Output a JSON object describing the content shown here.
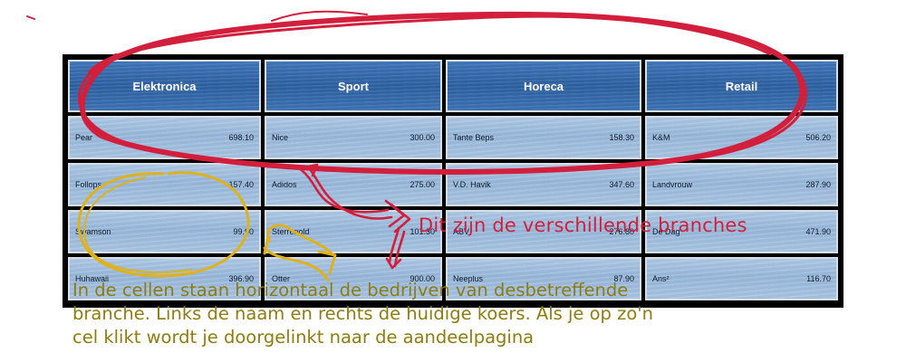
{
  "table": {
    "headers": [
      "Elektronica",
      "Sport",
      "Horeca",
      "Retail"
    ],
    "rows": [
      [
        {
          "name": "Pear",
          "price": "698.10"
        },
        {
          "name": "Nice",
          "price": "300.00"
        },
        {
          "name": "Tante Beps",
          "price": "158.30"
        },
        {
          "name": "K&M",
          "price": "506.20"
        }
      ],
      [
        {
          "name": "Follops",
          "price": "157.40"
        },
        {
          "name": "Adidos",
          "price": "275.00"
        },
        {
          "name": "V.D. Havik",
          "price": "347.60"
        },
        {
          "name": "Landvrouw",
          "price": "287.90"
        }
      ],
      [
        {
          "name": "Swamson",
          "price": "99.90"
        },
        {
          "name": "Sterrenold",
          "price": "101.30"
        },
        {
          "name": "ABV",
          "price": "276.80"
        },
        {
          "name": "De Dag",
          "price": "471.90"
        }
      ],
      [
        {
          "name": "Huhawaii",
          "price": "396.90"
        },
        {
          "name": "Otter",
          "price": "900.00"
        },
        {
          "name": "Neeplus",
          "price": "87.90"
        },
        {
          "name": "Ans²",
          "price": "116.70"
        }
      ]
    ]
  },
  "annotations": {
    "branches_note": "Dit zijn de verschillende branches",
    "explanation_lines": [
      "In de cellen staan horizontaal de bedrijven van  desbetreffende",
      "branche. Links de naam en rechts de huidige koers. Als je op zo'n",
      "cel klikt wordt je doorgelinkt naar de aandeelpagina"
    ]
  },
  "colors": {
    "red_annotation": "#d21f3c",
    "gold_annotation": "#e0b21a",
    "olive_text": "#8f7c10",
    "header_blue": "#2a5d9d",
    "cell_blue": "#a3bfdd"
  }
}
